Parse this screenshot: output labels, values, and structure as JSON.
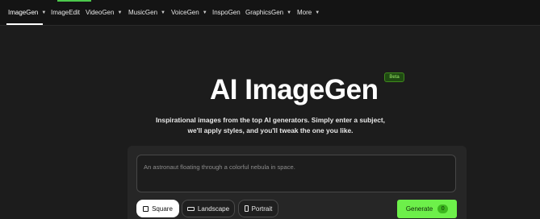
{
  "nav": {
    "items": [
      {
        "label": "ImageGen",
        "chevron": true
      },
      {
        "label": "ImageEdit",
        "chevron": false
      },
      {
        "label": "VideoGen",
        "chevron": true
      },
      {
        "label": "MusicGen",
        "chevron": true
      },
      {
        "label": "VoiceGen",
        "chevron": true
      },
      {
        "label": "InspoGen",
        "chevron": false
      },
      {
        "label": "GraphicsGen",
        "chevron": true
      },
      {
        "label": "More",
        "chevron": true
      }
    ],
    "active": "ImageGen"
  },
  "hero": {
    "title": "AI ImageGen",
    "badge": "Beta",
    "subtitle_line1": "Inspirational images from the top AI generators. Simply enter a subject,",
    "subtitle_line2": "we'll apply styles, and you'll tweak the one you like."
  },
  "prompt": {
    "placeholder": "An astronaut floating through a colorful nebula in space."
  },
  "aspect": {
    "options": [
      {
        "label": "Square",
        "icon": "square-icon"
      },
      {
        "label": "Landscape",
        "icon": "landscape-icon"
      },
      {
        "label": "Portrait",
        "icon": "portrait-icon"
      }
    ],
    "selected": "Square"
  },
  "generate": {
    "label": "Generate",
    "count": "0"
  },
  "colors": {
    "accent": "#6df04a",
    "background": "#1c1c1c",
    "nav_background": "#141414"
  }
}
